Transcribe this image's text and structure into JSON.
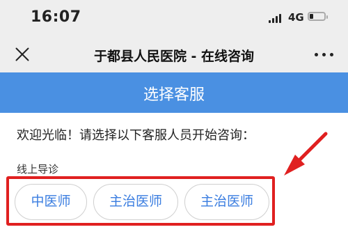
{
  "status_bar": {
    "time": "16:07",
    "network": "4G"
  },
  "nav": {
    "title": "于都县人民医院 - 在线咨询",
    "close_icon": "close-icon",
    "more_icon": "more-icon"
  },
  "header": {
    "title": "选择客服",
    "color": "#4a90e2"
  },
  "content": {
    "welcome": "欢迎光临！请选择以下客服人员开始咨询：",
    "section_label": "线上导诊",
    "options": [
      {
        "label": "中医师"
      },
      {
        "label": "主治医师"
      },
      {
        "label": "主治医师"
      }
    ]
  },
  "annotation": {
    "highlight_color": "#e02020"
  }
}
